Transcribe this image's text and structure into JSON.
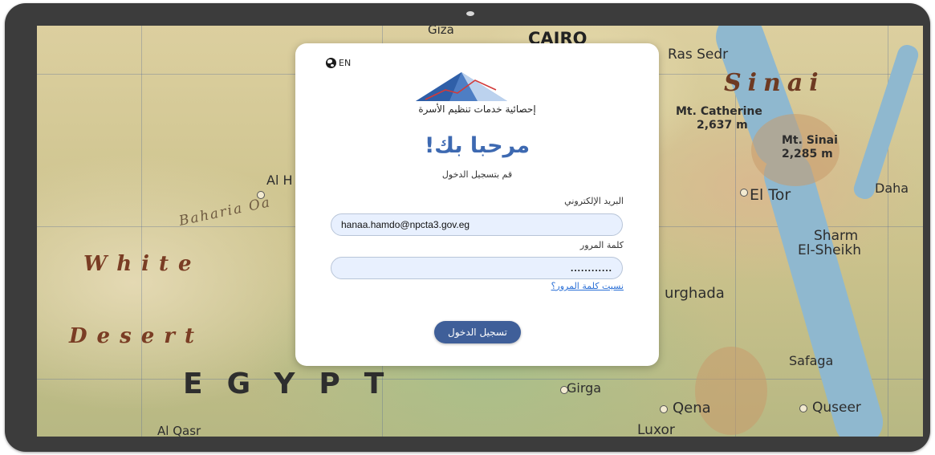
{
  "device": {
    "frame_color": "#3c3c3c"
  },
  "map": {
    "labels": {
      "giza": "Giza",
      "cairo": "CAIRO",
      "ras_sedr": "Ras Sedr",
      "sinai": "Sinai",
      "mt_catherine": "Mt. Catherine",
      "mt_catherine_height": "2,637 m",
      "mt_sinai": "Mt. Sinai",
      "mt_sinai_height": "2,285 m",
      "dahab": "Daha",
      "el_tor": "El Tor",
      "sharm": "Sharm",
      "el_sheikh": "El-Sheikh",
      "hurghada": "urghada",
      "safaga": "Safaga",
      "qena": "Qena",
      "quseer": "Quseer",
      "luxor": "Luxor",
      "girga": "Girga",
      "white": "White",
      "desert": "Desert",
      "egypt": "EGYPT",
      "bahariya": "Baharia Oa",
      "al_h": "Al H",
      "al_qasr": "Al Qasr"
    }
  },
  "login": {
    "lang_label": "EN",
    "logo_caption": "إحصائية خدمات تنظيم الأسرة",
    "title": "مرحبا بك!",
    "subtitle": "قم بتسجيل الدخول",
    "email_label": "البريد الإلكتروني",
    "email_value": "hanaa.hamdo@npcta3.gov.eg",
    "password_label": "كلمة المرور",
    "password_value": "............",
    "forgot_link": "نسيت كلمة المرور؟",
    "submit_label": "تسجيل الدخول",
    "accent_color": "#3d69b1",
    "button_color": "#3f5f99",
    "input_bg": "#e8f0fe"
  }
}
